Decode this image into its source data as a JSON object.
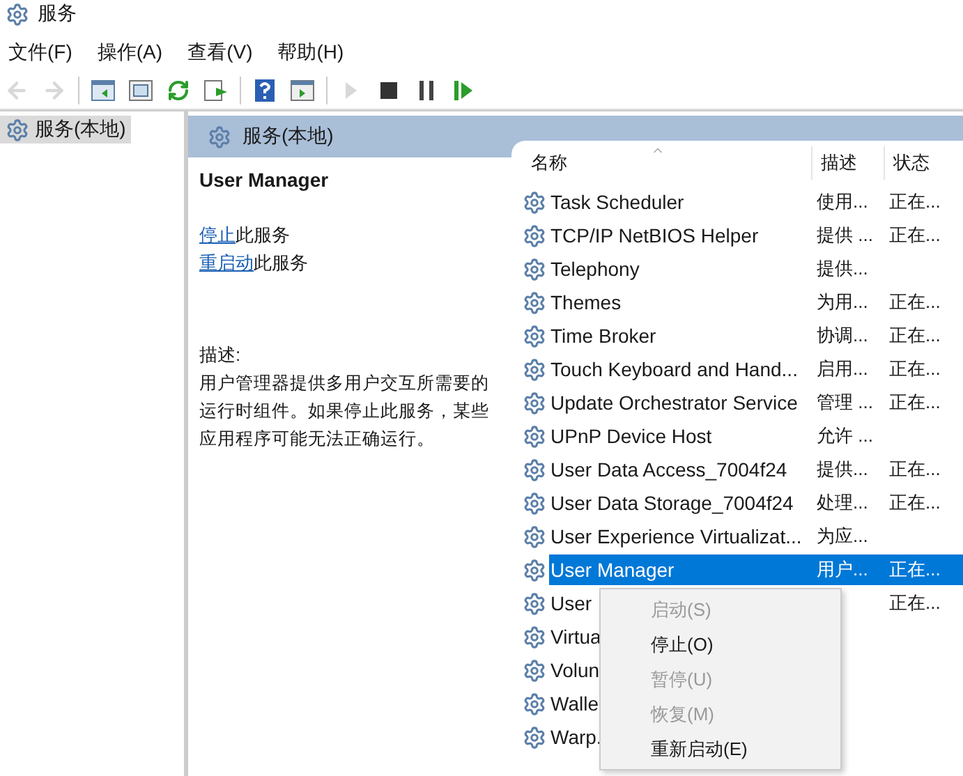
{
  "window": {
    "title": "服务"
  },
  "menu": [
    "文件(F)",
    "操作(A)",
    "查看(V)",
    "帮助(H)"
  ],
  "toolbar": [
    {
      "kind": "back",
      "disabled": true
    },
    {
      "kind": "forward",
      "disabled": true
    },
    {
      "kind": "sep"
    },
    {
      "kind": "console",
      "disabled": false
    },
    {
      "kind": "pane",
      "disabled": false
    },
    {
      "kind": "refresh",
      "disabled": false
    },
    {
      "kind": "export",
      "disabled": false
    },
    {
      "kind": "sep"
    },
    {
      "kind": "help",
      "disabled": false
    },
    {
      "kind": "view",
      "disabled": false
    },
    {
      "kind": "sep"
    },
    {
      "kind": "play",
      "disabled": true
    },
    {
      "kind": "stop",
      "disabled": false
    },
    {
      "kind": "pause",
      "disabled": false
    },
    {
      "kind": "resume",
      "disabled": false
    }
  ],
  "tree": [
    {
      "label": "服务(本地)",
      "selected": true
    }
  ],
  "pane": {
    "title": "服务(本地)"
  },
  "detail": {
    "name": "User Manager",
    "links": [
      {
        "link": "停止",
        "rest": "此服务"
      },
      {
        "link": "重启动",
        "rest": "此服务"
      }
    ],
    "description_label": "描述:",
    "description": "用户管理器提供多用户交互所需要的运行时组件。如果停止此服务，某些应用程序可能无法正确运行。"
  },
  "list": {
    "columns": [
      "名称",
      "描述",
      "状态"
    ],
    "rows": [
      {
        "name": "Task Scheduler",
        "description": "使用...",
        "status": "正在...",
        "selected": false
      },
      {
        "name": "TCP/IP NetBIOS Helper",
        "description": "提供 ...",
        "status": "正在...",
        "selected": false
      },
      {
        "name": "Telephony",
        "description": "提供...",
        "selected": false
      },
      {
        "name": "Themes",
        "description": "为用...",
        "status": "正在...",
        "selected": false
      },
      {
        "name": "Time Broker",
        "description": "协调...",
        "status": "正在...",
        "selected": false
      },
      {
        "name": "Touch Keyboard and Hand...",
        "description": "启用...",
        "status": "正在...",
        "selected": false
      },
      {
        "name": "Update Orchestrator Service",
        "description": "管理 ...",
        "status": "正在...",
        "selected": false
      },
      {
        "name": "UPnP Device Host",
        "description": "允许 ...",
        "selected": false
      },
      {
        "name": "User Data Access_7004f24",
        "description": "提供...",
        "status": "正在...",
        "selected": false
      },
      {
        "name": "User Data Storage_7004f24",
        "description": "处理...",
        "status": "正在...",
        "selected": false
      },
      {
        "name": "User Experience Virtualizat...",
        "description": "为应...",
        "selected": false
      },
      {
        "name": "User Manager",
        "description": "用户...",
        "status": "正在...",
        "selected": true
      },
      {
        "name": "User",
        "status": "正在...",
        "selected": false
      },
      {
        "name": "Virtua",
        "selected": false
      },
      {
        "name": "Volun",
        "selected": false
      },
      {
        "name": "Walle",
        "selected": false
      },
      {
        "name": "Warp.",
        "selected": false
      }
    ]
  },
  "context_menu": [
    {
      "label": "启动(S)",
      "disabled": true
    },
    {
      "label": "停止(O)",
      "disabled": false
    },
    {
      "label": "暂停(U)",
      "disabled": true
    },
    {
      "label": "恢复(M)",
      "disabled": true
    },
    {
      "label": "重新启动(E)",
      "disabled": false
    }
  ]
}
